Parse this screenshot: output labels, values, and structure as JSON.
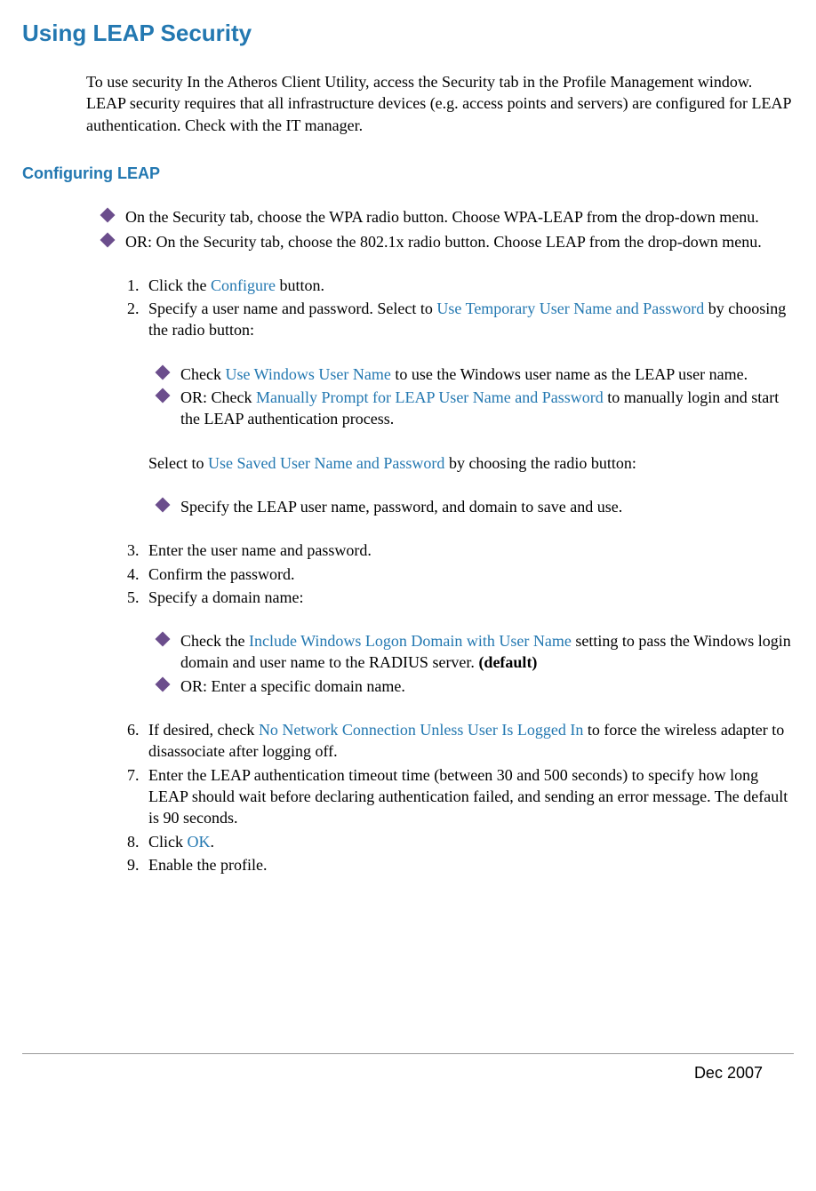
{
  "h1": "Using LEAP Security",
  "intro": "To use security In the Atheros Client Utility, access the Security tab in the Profile Management window. LEAP security requires that all infrastructure devices (e.g. access points and servers) are configured for LEAP authentication. Check with the IT manager.",
  "h2": "Configuring LEAP",
  "topBullets": {
    "b1": "On the Security tab, choose the WPA radio button. Choose WPA-LEAP from the drop-down menu.",
    "b2": "OR: On the Security tab, choose the 802.1x radio button. Choose LEAP from the drop-down menu."
  },
  "steps": {
    "s1": {
      "pre": "Click the ",
      "link": "Configure",
      "post": " button."
    },
    "s2": {
      "pre": "Specify a user name and password.  Select to ",
      "link": "Use Temporary User Name and Password",
      "post": " by choosing the radio button:"
    },
    "s2sub1": {
      "pre": "Check ",
      "link": "Use Windows User Name",
      "post": " to use the Windows user name as the LEAP user name."
    },
    "s2sub2": {
      "pre": "OR: Check ",
      "link": "Manually Prompt for LEAP User Name and Password",
      "post": " to manually login and start the LEAP authentication process."
    },
    "s2mid": {
      "pre": "Select to ",
      "link": "Use Saved User Name and Password",
      "post": " by choosing the radio button:"
    },
    "s2sub3": "Specify the LEAP user name, password, and domain to save and use.",
    "s3": "Enter the user name and password.",
    "s4": "Confirm the password.",
    "s5": "Specify a domain name:",
    "s5sub1": {
      "pre": "Check the ",
      "link": "Include Windows Logon Domain with User Name",
      "post": " setting to pass the Windows login domain and user name to the RADIUS server. ",
      "bold": "(default)"
    },
    "s5sub2": "OR: Enter a specific domain name.",
    "s6": {
      "pre": "If desired, check ",
      "link": "No Network Connection Unless User Is Logged In",
      "post": " to force the wireless adapter to disassociate after logging off."
    },
    "s7": "Enter the LEAP authentication timeout time (between 30 and 500 seconds) to specify how long LEAP should wait before declaring authentication failed, and sending an error message.  The default is 90 seconds.",
    "s8": {
      "pre": "Click ",
      "link": "OK",
      "post": "."
    },
    "s9": "Enable the profile."
  },
  "footer": "Dec 2007"
}
